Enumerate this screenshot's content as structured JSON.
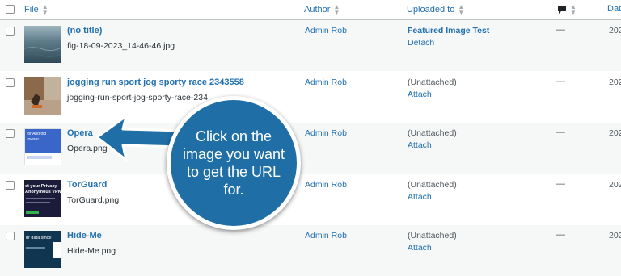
{
  "header": {
    "file": "File",
    "author": "Author",
    "uploaded_to": "Uploaded to",
    "date": "Dat"
  },
  "rows": [
    {
      "title": "(no title)",
      "filename": "fig-18-09-2023_14-46-46.jpg",
      "author": "Admin Rob",
      "uploaded_to": "Featured Image Test",
      "action": "Detach",
      "comments": "—",
      "date": "202"
    },
    {
      "title": "jogging run sport jog sporty race 2343558",
      "filename": "jogging-run-sport-jog-sporty-race-234",
      "author": "Admin Rob",
      "uploaded_to": "(Unattached)",
      "action": "Attach",
      "comments": "—",
      "date": "202"
    },
    {
      "title": "Opera",
      "filename": "Opera.png",
      "author": "Admin Rob",
      "uploaded_to": "(Unattached)",
      "action": "Attach",
      "comments": "—",
      "date": "202",
      "thumb_text": "for Android\nrowser"
    },
    {
      "title": "TorGuard",
      "filename": "TorGuard.png",
      "author": "Admin Rob",
      "uploaded_to": "(Unattached)",
      "action": "Attach",
      "comments": "—",
      "date": "202",
      "thumb_text": "ct your Privacy\nAnonymous VPN"
    },
    {
      "title": "Hide-Me",
      "filename": "Hide-Me.png",
      "author": "Admin Rob",
      "uploaded_to": "(Unattached)",
      "action": "Attach",
      "comments": "—",
      "date": "202",
      "thumb_text": "ur data since"
    }
  ],
  "callout": {
    "text": "Click on the image you want to get the URL for."
  },
  "colors": {
    "link": "#2271b1",
    "callout": "#1f6ea6",
    "alt_row": "#f6f7f7"
  },
  "icons": {
    "comments": "speech-bubble-icon",
    "sort": "sort-arrows-icon"
  }
}
